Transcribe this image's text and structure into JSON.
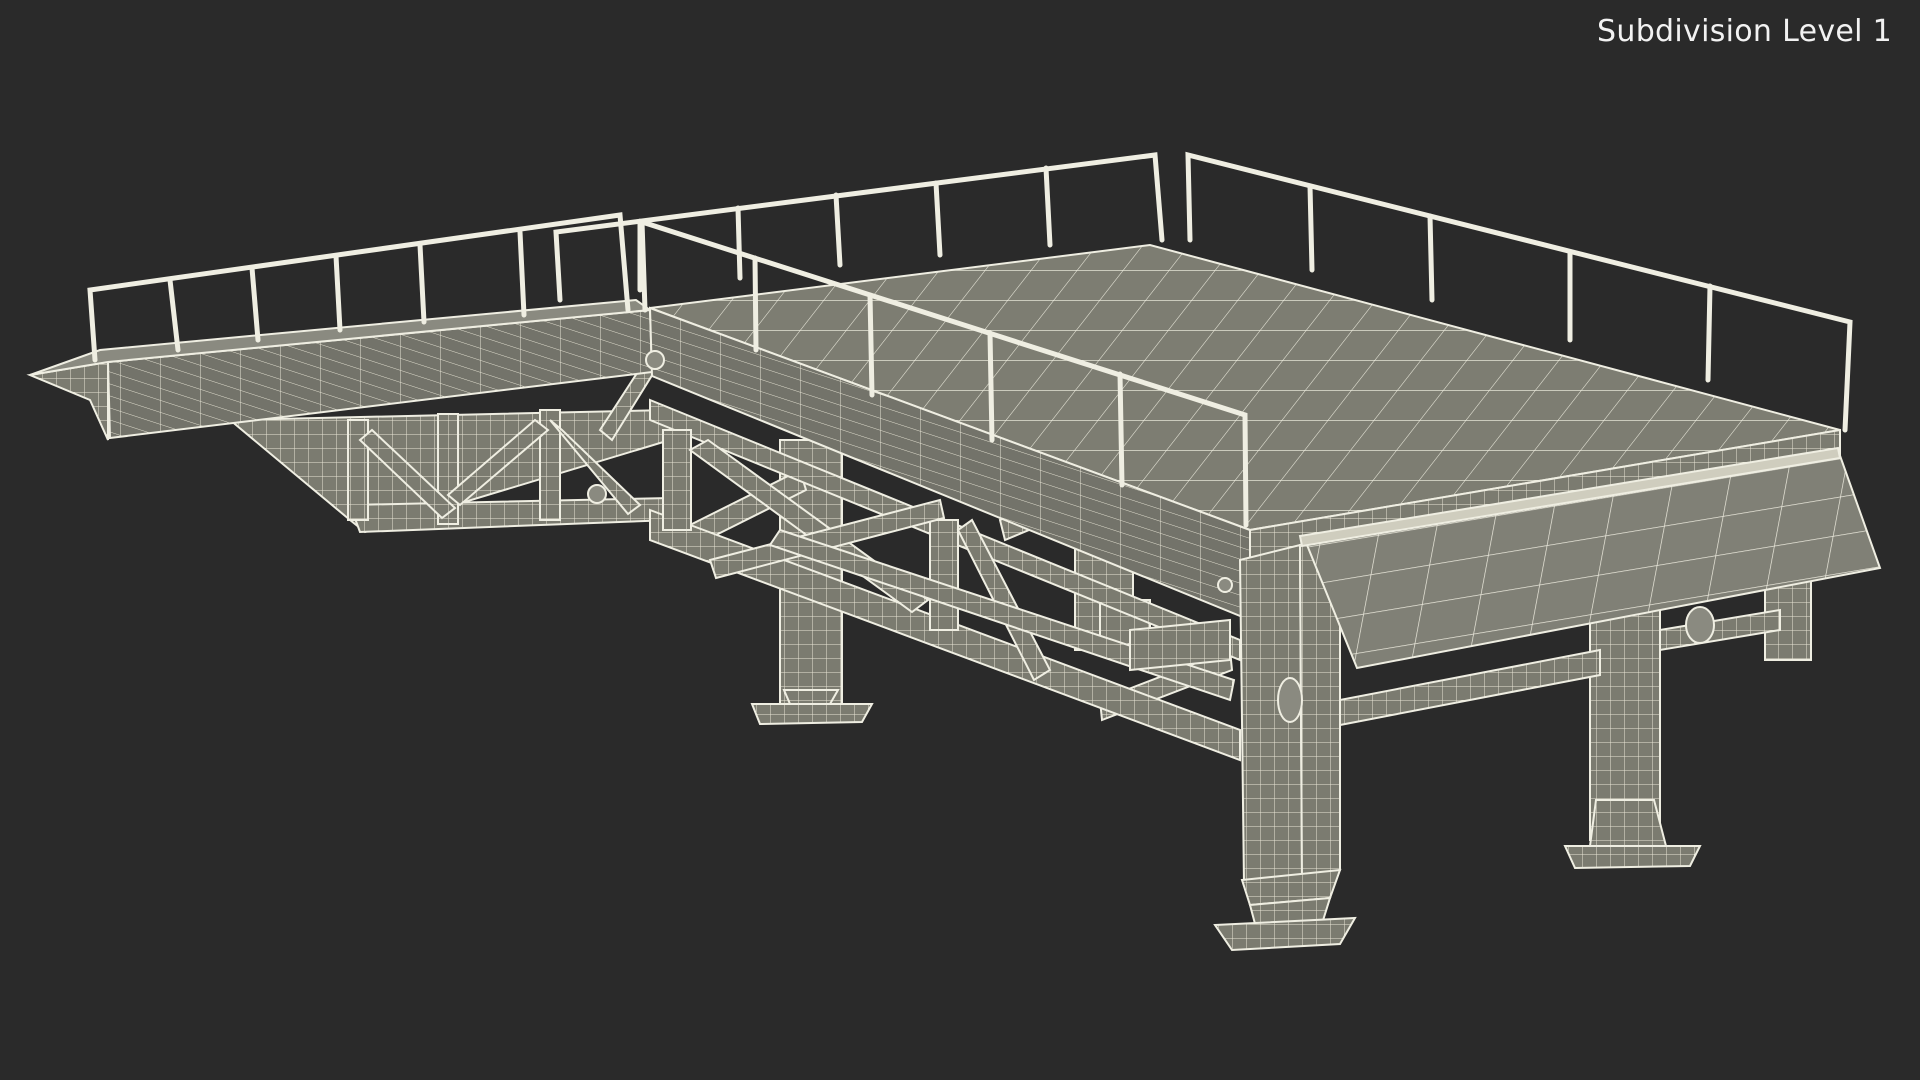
{
  "viewport": {
    "label": "Subdivision Level 1",
    "background": "#2a2a2a",
    "model_fill": "#7a7a70",
    "model_fill_light": "#8a8a80",
    "wire_color": "#efeee2"
  }
}
